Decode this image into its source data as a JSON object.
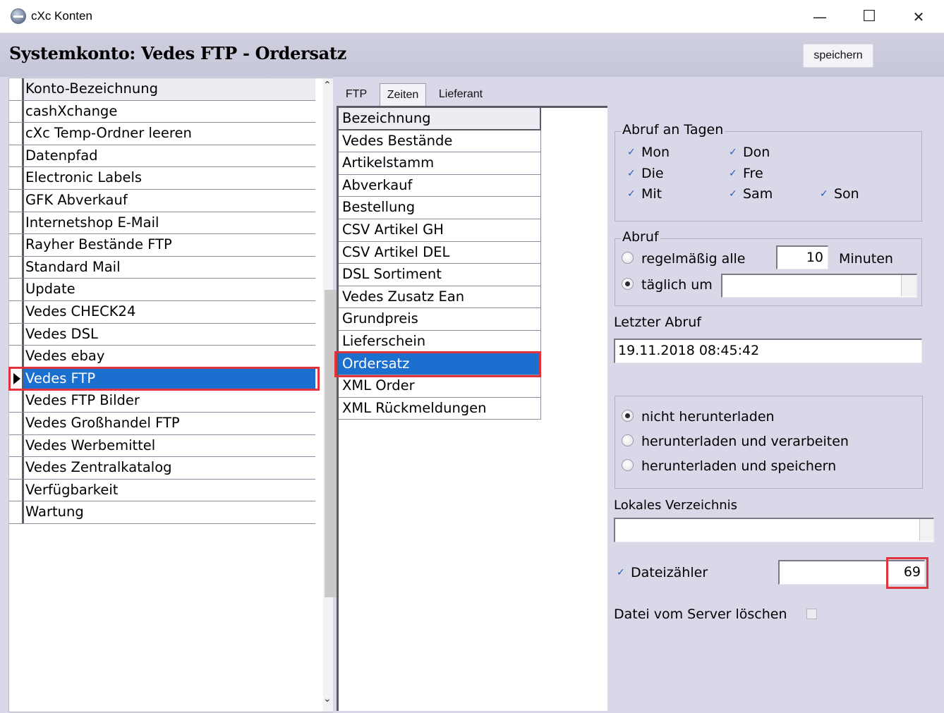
{
  "window": {
    "title": "cXc Konten",
    "controls": {
      "minimize": "—",
      "maximize": "☐",
      "close": "✕"
    }
  },
  "header": {
    "title": "Systemkonto: Vedes FTP - Ordersatz",
    "save_label": "speichern"
  },
  "accounts": {
    "column_header": "Konto-Bezeichnung",
    "items": [
      "cashXchange",
      "cXc Temp-Ordner leeren",
      "Datenpfad",
      "Electronic Labels",
      "GFK Abverkauf",
      "Internetshop E-Mail",
      "Rayher Bestände FTP",
      "Standard Mail",
      "Update",
      "Vedes CHECK24",
      "Vedes DSL",
      "Vedes ebay",
      "Vedes FTP",
      "Vedes FTP Bilder",
      "Vedes Großhandel FTP",
      "Vedes Werbemittel",
      "Vedes Zentralkatalog",
      "Verfügbarkeit",
      "Wartung"
    ],
    "selected": "Vedes FTP"
  },
  "tabs": [
    "FTP",
    "Zeiten",
    "Lieferant"
  ],
  "active_tab": "Zeiten",
  "records": {
    "column_header": "Bezeichnung",
    "items": [
      "Vedes Bestände",
      "Artikelstamm",
      "Abverkauf",
      "Bestellung",
      "CSV Artikel GH",
      "CSV Artikel DEL",
      "DSL Sortiment",
      "Vedes Zusatz Ean",
      "Grundpreis",
      "Lieferschein",
      "Ordersatz",
      "XML Order",
      "XML Rückmeldungen"
    ],
    "selected": "Ordersatz"
  },
  "days_group": {
    "title": "Abruf an Tagen",
    "days": [
      {
        "label": "Mon",
        "checked": true
      },
      {
        "label": "Don",
        "checked": true
      },
      {
        "label": "Die",
        "checked": true
      },
      {
        "label": "Fre",
        "checked": true
      },
      {
        "label": "Mit",
        "checked": true
      },
      {
        "label": "Sam",
        "checked": true
      },
      {
        "label": "Son",
        "checked": true
      }
    ]
  },
  "abruf_group": {
    "title": "Abruf",
    "regular_label": "regelmäßig alle",
    "interval_value": "10",
    "interval_unit": "Minuten",
    "daily_label": "täglich um",
    "daily_value": "",
    "selected": "täglich um"
  },
  "last_fetch": {
    "label": "Letzter Abruf",
    "value": "19.11.2018 08:45:42"
  },
  "download_group": {
    "options": [
      "nicht herunterladen",
      "herunterladen und verarbeiten",
      "herunterladen und speichern"
    ],
    "selected": "nicht herunterladen"
  },
  "local_dir": {
    "label": "Lokales Verzeichnis",
    "value": ""
  },
  "file_counter": {
    "label": "Dateizähler",
    "checked": true,
    "value": "69"
  },
  "delete_from_server": {
    "label": "Datei vom Server löschen",
    "checked": false
  },
  "glyphs": {
    "check": "✓",
    "scroll_up": "⌃",
    "scroll_down": "⌄"
  }
}
